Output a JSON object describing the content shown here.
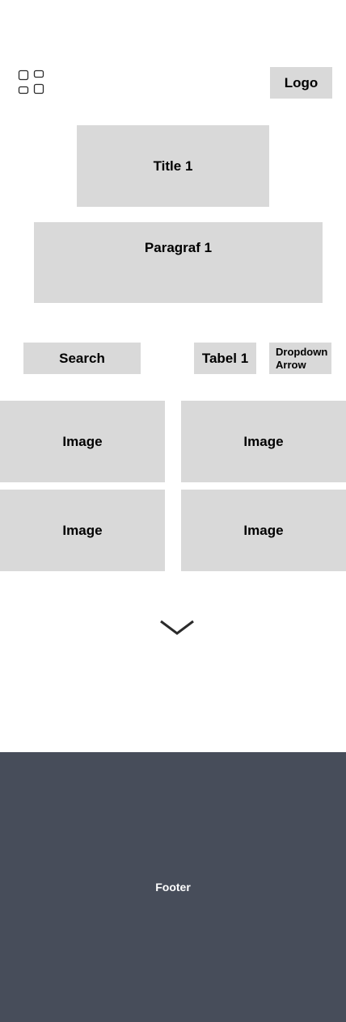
{
  "header": {
    "menu_icon": "grid-menu-icon",
    "logo_label": "Logo"
  },
  "hero": {
    "title": "Title 1",
    "paragraph": "Paragraf 1"
  },
  "toolbar": {
    "search_label": "Search",
    "tabel_label": "Tabel 1",
    "dropdown_label": "Dropdown\nArrow"
  },
  "gallery": {
    "images": [
      {
        "label": "Image"
      },
      {
        "label": "Image"
      },
      {
        "label": "Image"
      },
      {
        "label": "Image"
      }
    ]
  },
  "scroll": {
    "icon": "chevron-down-icon"
  },
  "footer": {
    "label": "Footer"
  },
  "colors": {
    "placeholder": "#d9d9d9",
    "footer_bg": "#474d5a",
    "footer_text": "#ffffff",
    "icon_stroke": "#2b2b2b"
  }
}
